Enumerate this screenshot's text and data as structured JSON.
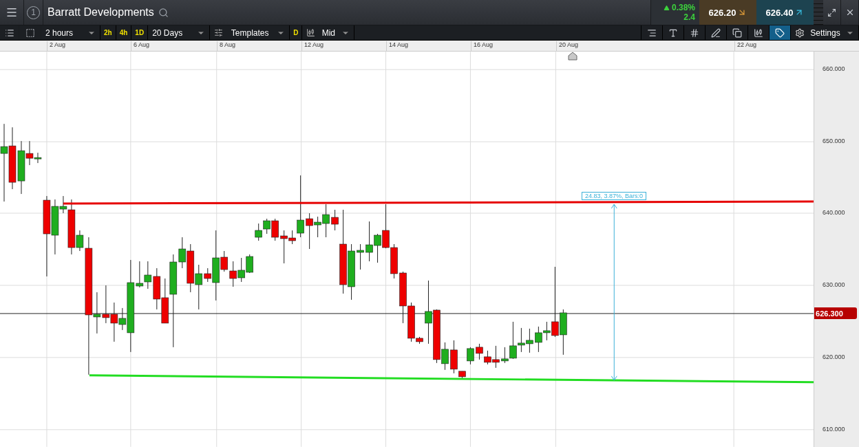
{
  "header": {
    "badge": "1",
    "symbol": "Barratt Developments",
    "change_pct": "0.38%",
    "change": "2.4",
    "sell": "626.20",
    "buy": "626.40"
  },
  "toolbar": {
    "interval": "2 hours",
    "quick_intervals": [
      "2h",
      "4h",
      "1D"
    ],
    "range": "20 Days",
    "templates": "Templates",
    "mode": "D",
    "price_type": "Mid",
    "settings": "Settings",
    "tools": [
      {
        "kind": "scale",
        "selected": false
      },
      {
        "kind": "text",
        "selected": false
      },
      {
        "kind": "grid",
        "selected": false
      },
      {
        "kind": "draw",
        "selected": false
      },
      {
        "kind": "layers",
        "selected": false
      },
      {
        "kind": "candle",
        "selected": false
      },
      {
        "kind": "tag",
        "selected": true
      }
    ]
  },
  "date_axis": [
    "2 Aug",
    "6 Aug",
    "8 Aug",
    "12 Aug",
    "14 Aug",
    "16 Aug",
    "20 Aug",
    "22 Aug"
  ],
  "price_axis": [
    "660.000",
    "650.000",
    "640.000",
    "630.000",
    "620.000",
    "610.000"
  ],
  "current_price": "626.300",
  "measurement": "24.83, 3.87%, Bars:0"
}
